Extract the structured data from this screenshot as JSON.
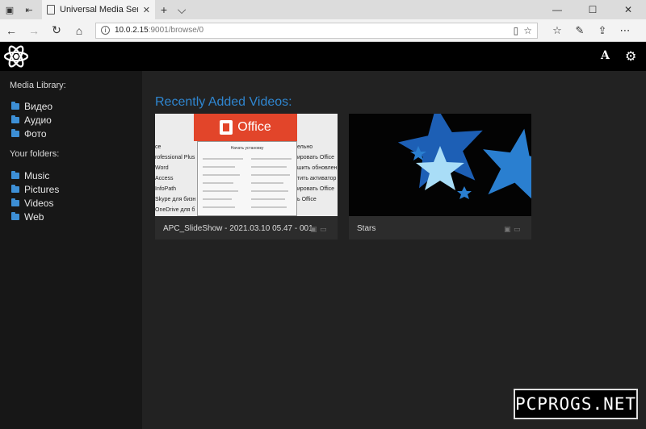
{
  "browser": {
    "tab_title": "Universal Media Server",
    "tab_close": "✕",
    "new_tab": "+",
    "tab_menu": "⌵",
    "minimize": "—",
    "maximize": "☐",
    "close": "✕",
    "url_host": "10.0.2.15",
    "url_path": ":9001/browse/0"
  },
  "app": {
    "font_button": "A",
    "settings_icon": "gear-icon"
  },
  "sidebar": {
    "media_library_title": "Media Library:",
    "media_library": [
      {
        "label": "Видео"
      },
      {
        "label": "Аудио"
      },
      {
        "label": "Фото"
      }
    ],
    "folders_title": "Your folders:",
    "folders": [
      {
        "label": "Music"
      },
      {
        "label": "Pictures"
      },
      {
        "label": "Videos"
      },
      {
        "label": "Web"
      }
    ]
  },
  "main": {
    "heading": "Recently Added Videos:",
    "videos": [
      {
        "caption": "APC_SlideShow - 2021.03.10 05.47 - 001",
        "thumb": {
          "brand": "Office",
          "dialog_title": "Начать установку",
          "left_col": [
            "ce",
            "rofessional Plus",
            "Word",
            "Access",
            "InfoPath",
            "Skype для бизн",
            "OneDrive для б"
          ],
          "right_col": [
            "ельно",
            "ировать Office",
            "шить обновлен",
            "тить активатор",
            "ировать Office",
            "ь Office"
          ]
        }
      },
      {
        "caption": "Stars"
      }
    ]
  },
  "watermark": "PCPROGS.NET"
}
